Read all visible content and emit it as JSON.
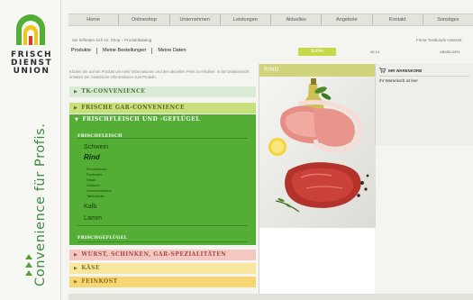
{
  "brand": {
    "words": [
      "FRISCH",
      "DIENST",
      "UNION"
    ],
    "slogan": "Convenience für Profis.",
    "colors": {
      "green": "#54ae35",
      "red": "#d63a2c",
      "yellow": "#f2c51e"
    }
  },
  "topnav": [
    "Home",
    "Onlineshop",
    "Unternehmen",
    "Leistungen",
    "Aktuelles",
    "Angebote",
    "Kontakt",
    "Sonstiges"
  ],
  "breadcrumb": "Sie befinden sich im: Shop – Produktkatalog",
  "company": "Firma Testkunde Unterstr.",
  "subnav": [
    "Produkte",
    "Meine Bestellungen",
    "Meine Daten"
  ],
  "search": {
    "button": "Suche",
    "label_a": "08.10.",
    "label_b": "ABMELDEN"
  },
  "intro": "Klicken Sie auf ein Produkt um mehr Informationen und den aktuellen Preis zu erhalten. In der Detailansicht erhalten Sie zusätzliche Informationen zum Produkt.",
  "categories": {
    "tk": "TK-CONVENIENCE",
    "gar": "FRISCHE GAR-CONVENIENCE",
    "fleisch": "FRISCHFLEISCH UND -GEFLÜGEL",
    "wurst": "WURST, SCHINKEN, GAR-SPEZIALITÄTEN",
    "kaese": "KÄSE",
    "feinkost": "FEINKOST"
  },
  "fleisch": {
    "subtitle": "FRISCHFLEISCH",
    "schwein": "Schwein",
    "rind": "Rind",
    "rind_items": [
      "Einzelstücke",
      "Rouladen",
      "Steak",
      "Gulasch",
      "Geschnetzeltes",
      "Tafelstücke"
    ],
    "kalb": "Kalb",
    "lamm": "Lamm",
    "gefluegel": "FRISCHGEFLÜGEL"
  },
  "image_panel": {
    "title": "RIND"
  },
  "cart": {
    "title": "IHR WARENKORB",
    "empty": "Ihr Warenkorb ist leer"
  }
}
